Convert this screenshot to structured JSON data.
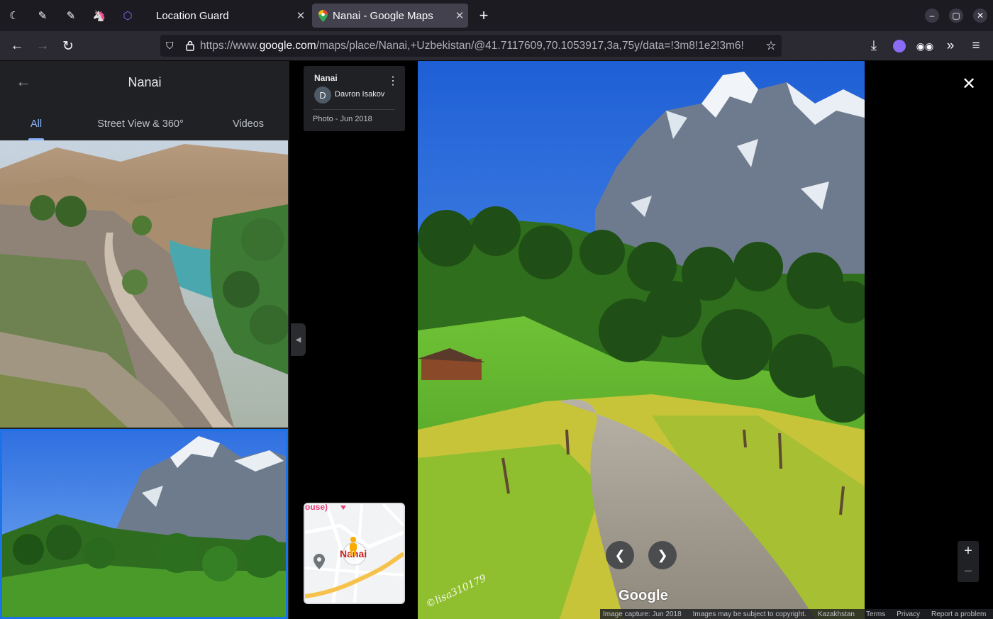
{
  "browser": {
    "pinned_tabs": [
      {
        "icon": "clock-icon",
        "glyph": "☾"
      },
      {
        "icon": "notes-icon",
        "glyph": "✎"
      },
      {
        "icon": "notes-alt-icon",
        "glyph": "✎"
      },
      {
        "icon": "unicorn-icon",
        "glyph": "🦄"
      },
      {
        "icon": "hexagon-icon",
        "glyph": "⬡"
      }
    ],
    "tabs": [
      {
        "label": "Location Guard",
        "active": false
      },
      {
        "label": "Nanai - Google Maps",
        "active": true
      }
    ],
    "new_tab_glyph": "+",
    "url_prefix": "https://www.",
    "url_domain": "google.com",
    "url_rest": "/maps/place/Nanai,+Uzbekistan/@41.7117609,70.1053917,3a,75y/data=!3m8!1e2!3m6!",
    "window_controls": [
      "–",
      "▢",
      "✕"
    ]
  },
  "panel": {
    "title": "Nanai",
    "tabs": [
      "All",
      "Street View & 360°",
      "Videos"
    ],
    "active_tab": 0
  },
  "photo_info": {
    "place": "Nanai",
    "avatar_letter": "D",
    "author": "Davron Isakov",
    "date": "Photo - Jun 2018"
  },
  "minimap": {
    "label": "Nanai",
    "cut_label": "ouse)"
  },
  "viewer": {
    "logo": "Google",
    "watermark": "©lisa310179",
    "footer": [
      "Image capture: Jun 2018",
      "Images may be subject to copyright.",
      "Kazakhstan",
      "Terms",
      "Privacy",
      "Report a problem"
    ],
    "zoom_in": "+",
    "zoom_out": "−"
  },
  "colors": {
    "accent": "#8ab4f8",
    "selected_outline": "#1a73e8"
  }
}
